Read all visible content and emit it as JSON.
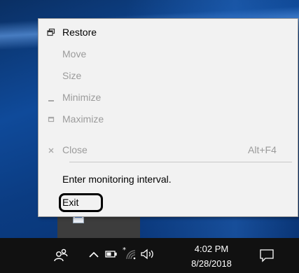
{
  "menu": {
    "items": [
      {
        "glyph": "restore-icon",
        "label": "Restore",
        "enabled": true
      },
      {
        "glyph": "",
        "label": "Move",
        "enabled": false
      },
      {
        "glyph": "",
        "label": "Size",
        "enabled": false
      },
      {
        "glyph": "minimize-icon",
        "label": "Minimize",
        "enabled": false
      },
      {
        "glyph": "maximize-icon",
        "label": "Maximize",
        "enabled": false
      },
      {
        "glyph": "close-x-icon",
        "label": "Close",
        "accel": "Alt+F4",
        "enabled": false
      },
      {
        "glyph": "",
        "label": "Enter monitoring interval.",
        "enabled": true
      },
      {
        "glyph": "",
        "label": "Exit",
        "enabled": true
      }
    ]
  },
  "taskbar": {
    "time": "4:02 PM",
    "date": "8/28/2018",
    "icons": [
      "people-icon",
      "chevron-up-icon",
      "battery-icon",
      "wifi-icon",
      "volume-icon",
      "action-center-icon"
    ]
  },
  "colors": {
    "menu_bg": "#f2f2f2",
    "disabled_text": "#9b9b9b",
    "taskbar_bg": "#111111",
    "desktop_accent": "#0f4a9a"
  }
}
